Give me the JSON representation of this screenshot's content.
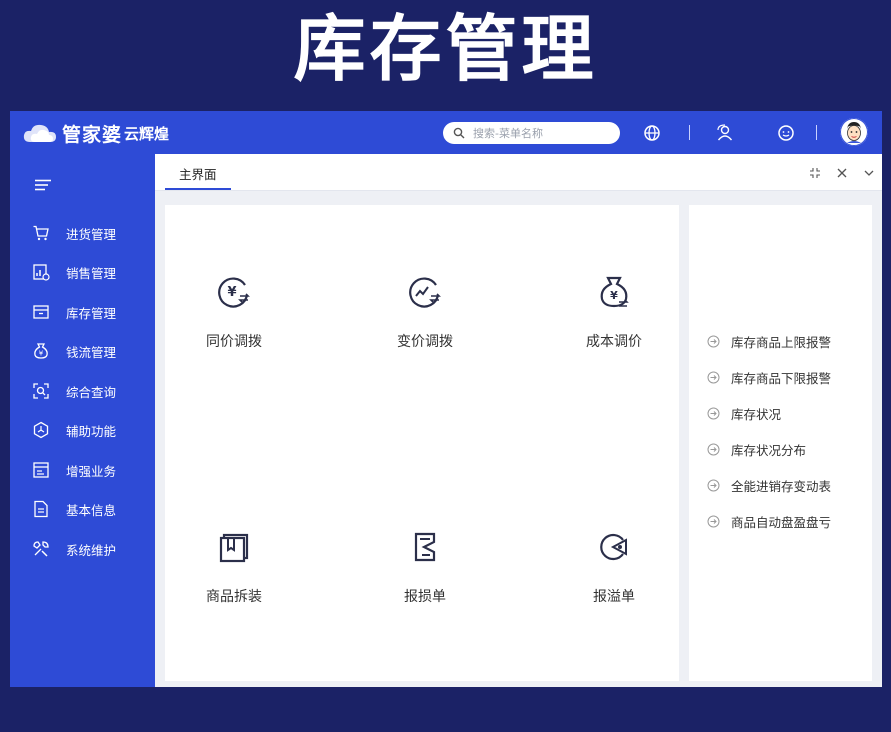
{
  "banner": {
    "title": "库存管理"
  },
  "app": {
    "brand": {
      "name": "管家婆",
      "product": "云辉煌"
    },
    "search": {
      "placeholder": "搜索-菜单名称"
    },
    "tab": {
      "label": "主界面"
    }
  },
  "sidebar": {
    "items": [
      {
        "label": "进货管理",
        "icon": "cart-icon"
      },
      {
        "label": "销售管理",
        "icon": "sales-chart-icon"
      },
      {
        "label": "库存管理",
        "icon": "inventory-box-icon"
      },
      {
        "label": "钱流管理",
        "icon": "money-bag-icon"
      },
      {
        "label": "综合查询",
        "icon": "search-frame-icon"
      },
      {
        "label": "辅助功能",
        "icon": "hexagon-icon"
      },
      {
        "label": "增强业务",
        "icon": "window-icon"
      },
      {
        "label": "基本信息",
        "icon": "document-icon"
      },
      {
        "label": "系统维护",
        "icon": "tools-icon"
      }
    ]
  },
  "functions": [
    {
      "label": "同价调拨",
      "icon": "yen-transfer-icon"
    },
    {
      "label": "变价调拨",
      "icon": "trend-transfer-icon"
    },
    {
      "label": "成本调价",
      "icon": "money-bag-icon"
    },
    {
      "label": "商品拆装",
      "icon": "package-icon"
    },
    {
      "label": "报损单",
      "icon": "loss-report-icon"
    },
    {
      "label": "报溢单",
      "icon": "overflow-report-icon"
    }
  ],
  "quick_links": [
    "库存商品上限报警",
    "库存商品下限报警",
    "库存状况",
    "库存状况分布",
    "全能进销存变动表",
    "商品自动盘盈盘亏"
  ],
  "colors": {
    "brand": "#2e4bd6",
    "background": "#1b2266",
    "icon_dark": "#2b2f4a"
  }
}
